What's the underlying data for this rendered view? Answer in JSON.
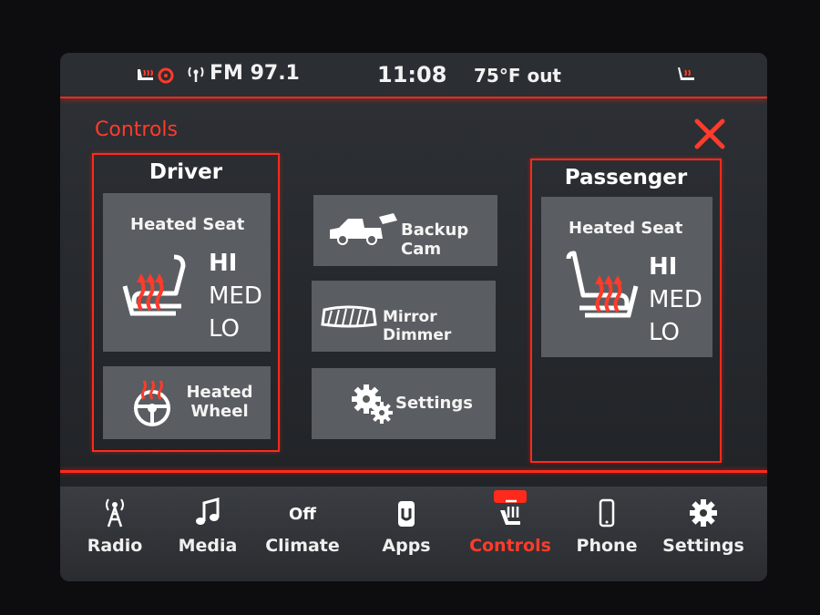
{
  "status": {
    "radio": "FM 97.1",
    "time": "11:08",
    "temp": "75°F out"
  },
  "page": {
    "title": "Controls"
  },
  "driver": {
    "title": "Driver",
    "heated_seat": {
      "label": "Heated Seat",
      "levels": [
        "HI",
        "MED",
        "LO"
      ]
    },
    "heated_wheel": {
      "line1": "Heated",
      "line2": "Wheel"
    }
  },
  "center": {
    "backup_cam": "Backup Cam",
    "mirror_dimmer": "Mirror Dimmer",
    "settings": "Settings"
  },
  "passenger": {
    "title": "Passenger",
    "heated_seat": {
      "label": "Heated Seat",
      "levels": [
        "HI",
        "MED",
        "LO"
      ]
    }
  },
  "nav": {
    "items": [
      {
        "label": "Radio",
        "icon": "radio-tower-icon"
      },
      {
        "label": "Media",
        "icon": "music-note-icon"
      },
      {
        "label": "Climate",
        "icon": "climate-off-text",
        "top_text": "Off"
      },
      {
        "label": "Apps",
        "icon": "apps-icon"
      },
      {
        "label": "Controls",
        "icon": "controls-icon",
        "active": true
      },
      {
        "label": "Phone",
        "icon": "phone-icon"
      },
      {
        "label": "Settings",
        "icon": "gear-icon"
      }
    ]
  },
  "colors": {
    "accent": "#ff2a1c",
    "tile": "#5a5d61",
    "heat": "#ff3b2b"
  }
}
